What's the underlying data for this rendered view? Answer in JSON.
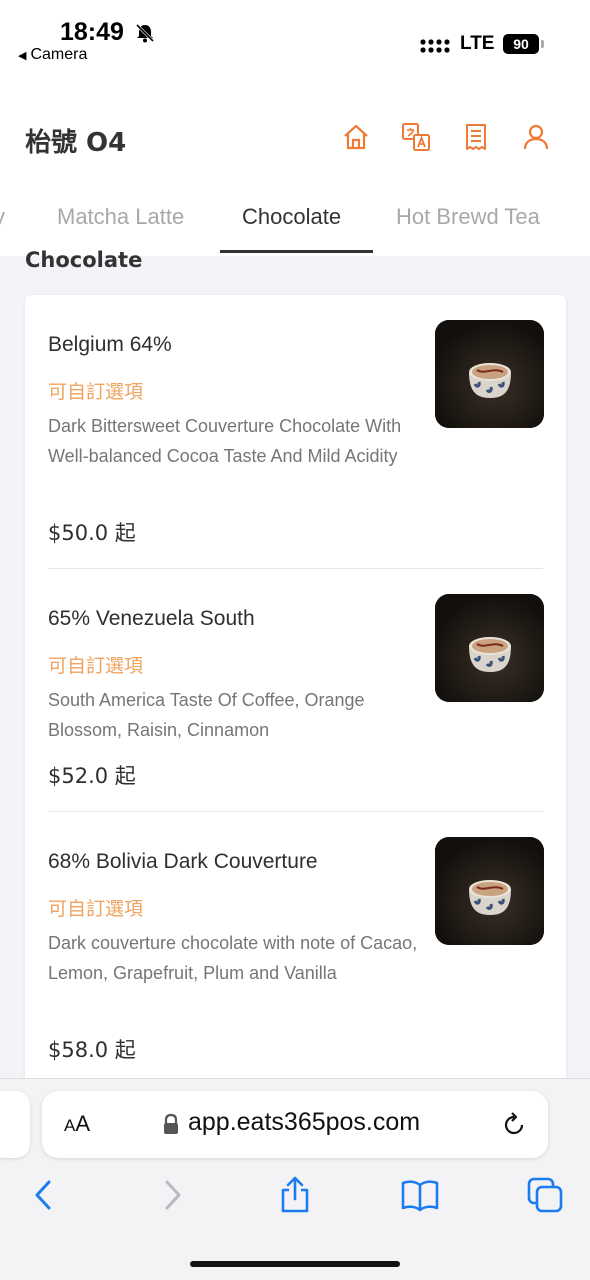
{
  "status_bar": {
    "time": "18:49",
    "back_app": "Camera",
    "network": "LTE",
    "battery": "90"
  },
  "header": {
    "store_name": "枱號 O4",
    "icons": [
      "home-icon",
      "translate-icon",
      "receipt-icon",
      "user-icon"
    ],
    "accent_color": "#ee7a35"
  },
  "tabs": [
    {
      "label": "y",
      "active": false
    },
    {
      "label": "Matcha Latte",
      "active": false
    },
    {
      "label": "Chocolate",
      "active": true
    },
    {
      "label": "Hot Brewd Tea",
      "active": false
    }
  ],
  "section": {
    "title": "Chocolate"
  },
  "menu_items": [
    {
      "name": "Belgium 64%",
      "option_label": "可自訂選項",
      "description": "Dark Bittersweet Couverture Chocolate With Well-balanced Cocoa Taste And Mild Acidity",
      "price": "$50.0 起"
    },
    {
      "name": "65% Venezuela South",
      "option_label": "可自訂選項",
      "description": "South America Taste Of Coffee, Orange Blossom, Raisin, Cinnamon",
      "price": "$52.0 起"
    },
    {
      "name": "68% Bolivia Dark Couverture",
      "option_label": "可自訂選項",
      "description": "Dark couverture chocolate with note of Cacao, Lemon, Grapefruit, Plum and Vanilla",
      "price": "$58.0 起"
    }
  ],
  "browser": {
    "text_size_label_small": "A",
    "text_size_label_large": "A",
    "url": "app.eats365pos.com",
    "icon_color": "#1a7cf0"
  }
}
